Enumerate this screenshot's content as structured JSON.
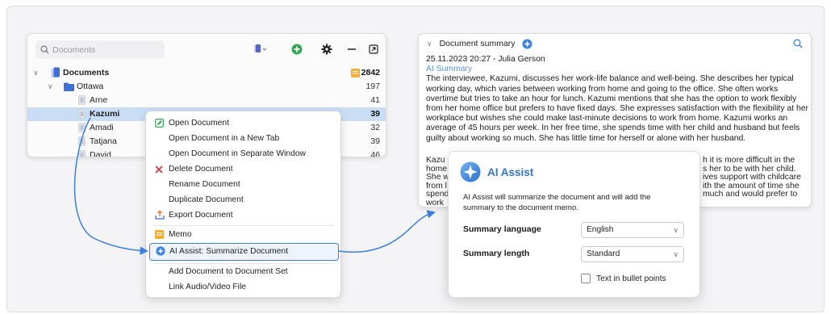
{
  "documents_panel": {
    "search_placeholder": "Documents",
    "tree": [
      {
        "label": "Documents",
        "count": "2842"
      },
      {
        "label": "Ottawa",
        "count": "197"
      },
      {
        "label": "Arne",
        "count": "41"
      },
      {
        "label": "Kazumi",
        "count": "39"
      },
      {
        "label": "Amadi",
        "count": "32"
      },
      {
        "label": "Tatjana",
        "count": "39"
      },
      {
        "label": "David",
        "count": "46"
      }
    ]
  },
  "context_menu": {
    "items": [
      "Open Document",
      "Open Document in a New Tab",
      "Open Document in Separate Window",
      "Delete Document",
      "Rename Document",
      "Duplicate Document",
      "Export Document",
      "Memo",
      "AI Assist: Summarize Document",
      "Add Document to Document Set",
      "Link Audio/Video File"
    ]
  },
  "summary_panel": {
    "title": "Document summary",
    "meta": "25.11.2023 20:27 - Julia Gerson",
    "ai_label": "AI Summary",
    "paragraph1": "The interviewee, Kazumi, discusses her work-life balance and well-being. She describes her typical working day, which varies between working from home and going to the office. She often works overtime but tries to take an hour for lunch. Kazumi mentions that she has the option to work flexibly from her home office but prefers to have fixed days. She expresses satisfaction with the flexibility at her workplace but wishes she could make last-minute decisions to work from home. Kazumi works an average of 45 hours per week. In her free time, she spends time with her child and husband but feels guilty about working so much. She has little time for herself or alone with her husband.",
    "partial_left": [
      "Kazu",
      "home",
      "She w",
      "from l",
      "spend",
      "work"
    ],
    "partial_right": [
      "h it is more difficult in the",
      "s her to be with her child.",
      "ives support with childcare",
      "ith the amount of time she",
      "much and would prefer to"
    ]
  },
  "ai_dialog": {
    "title": "AI Assist",
    "description": "AI Assist will summarize the document and will add the summary to the document memo.",
    "language_label": "Summary language",
    "language_value": "English",
    "length_label": "Summary length",
    "length_value": "Standard",
    "bullet_label": "Text in bullet points",
    "bullet_checked": false
  },
  "colors": {
    "accent": "#3d7fdc",
    "selection": "#c9def5",
    "ai_text": "#3574c9",
    "add_green": "#2fa84f",
    "memo_yellow": "#f2b134",
    "delete_red": "#d93a3a",
    "edit_green": "#3aa55a"
  },
  "icons": {
    "search": "search-icon",
    "new_doc": "new-document-icon",
    "add": "add-icon",
    "settings": "gear-icon",
    "minimize": "minimize-icon",
    "popout": "popout-icon"
  }
}
